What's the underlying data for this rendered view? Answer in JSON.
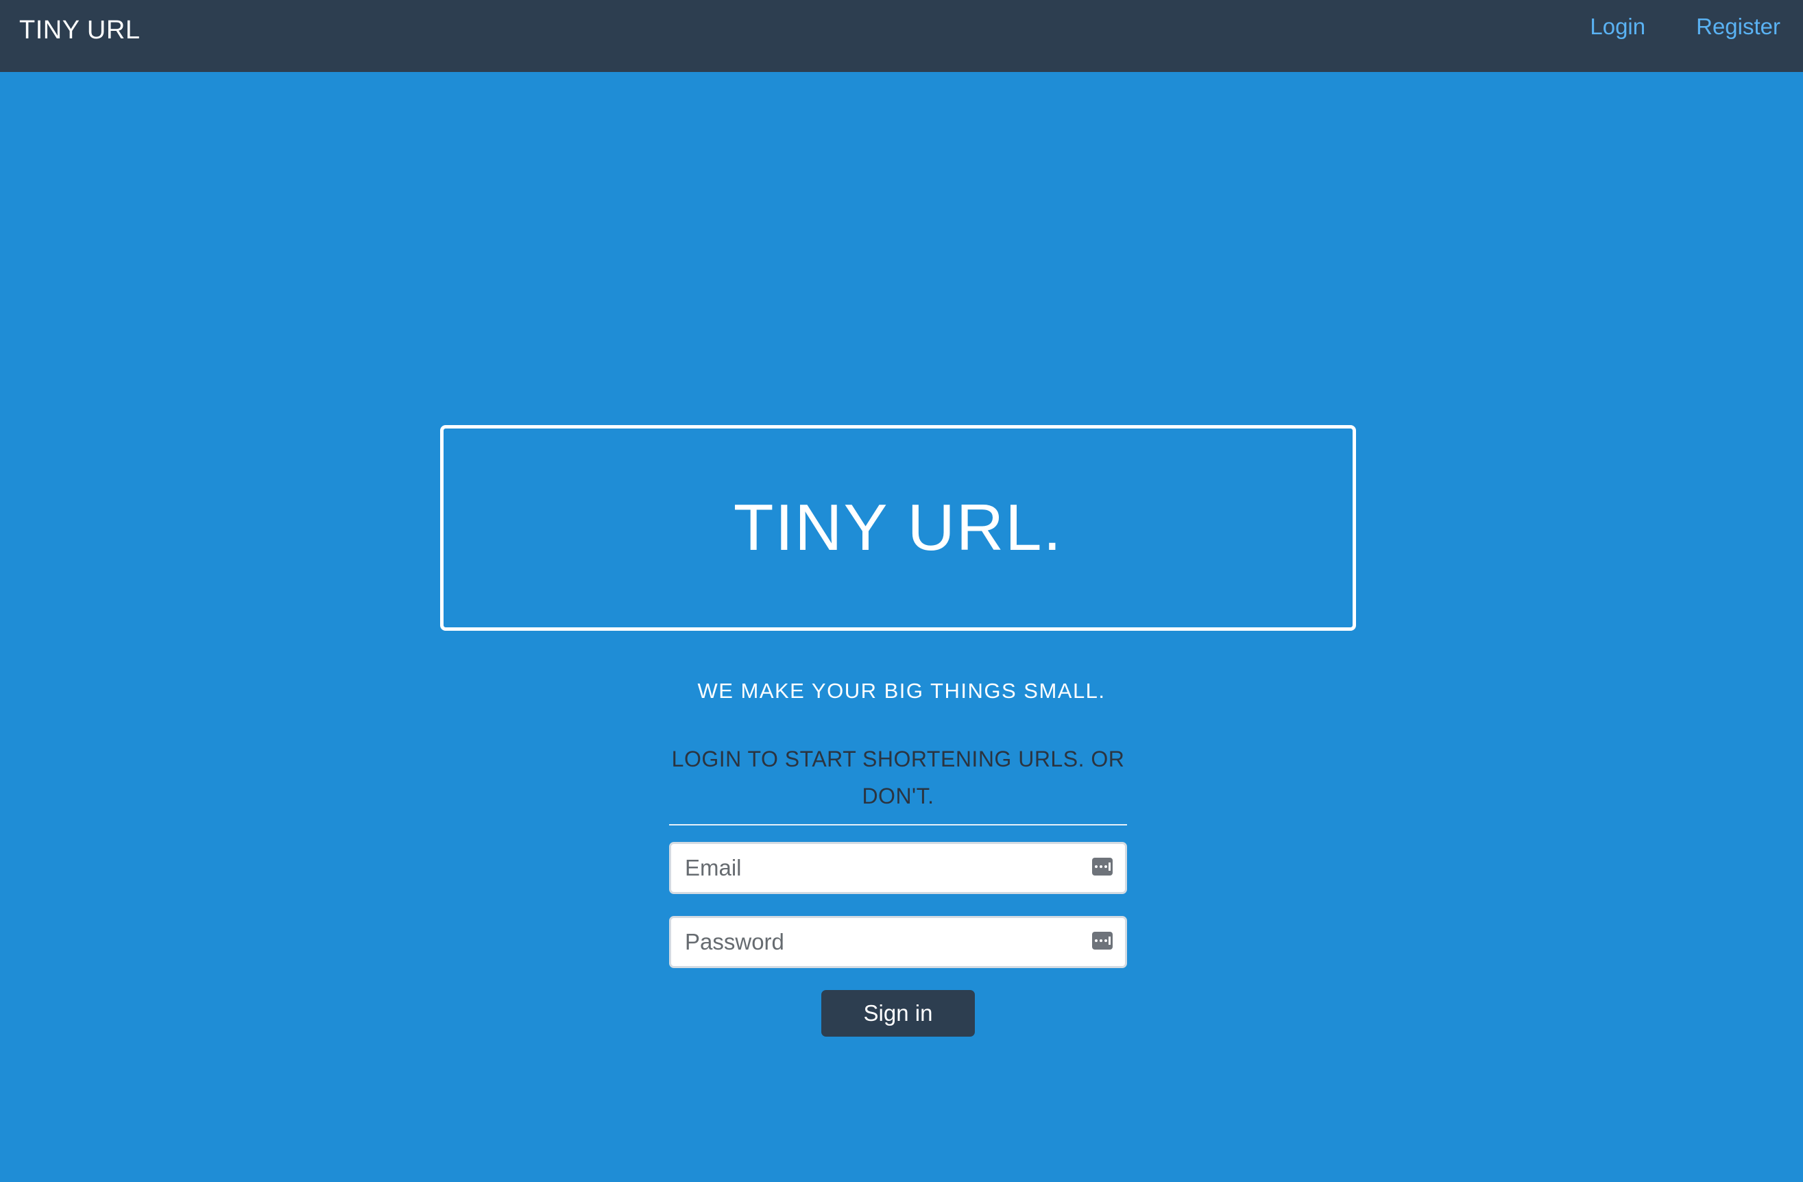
{
  "navbar": {
    "brand": "TINY URL",
    "links": [
      {
        "label": "Login"
      },
      {
        "label": "Register"
      }
    ]
  },
  "hero": {
    "title": "TINY URL."
  },
  "tagline": "WE MAKE YOUR BIG THINGS SMALL.",
  "login_form": {
    "prompt": "LOGIN TO START SHORTENING URLS. OR DON'T.",
    "email": {
      "placeholder": "Email",
      "value": ""
    },
    "password": {
      "placeholder": "Password",
      "value": ""
    },
    "submit_label": "Sign in"
  },
  "icons": {
    "field_autofill": "password-key-icon"
  },
  "colors": {
    "background": "#1f8dd6",
    "navbar": "#2d3e50",
    "nav_link": "#5ab2f3",
    "button": "#2d3e50"
  }
}
